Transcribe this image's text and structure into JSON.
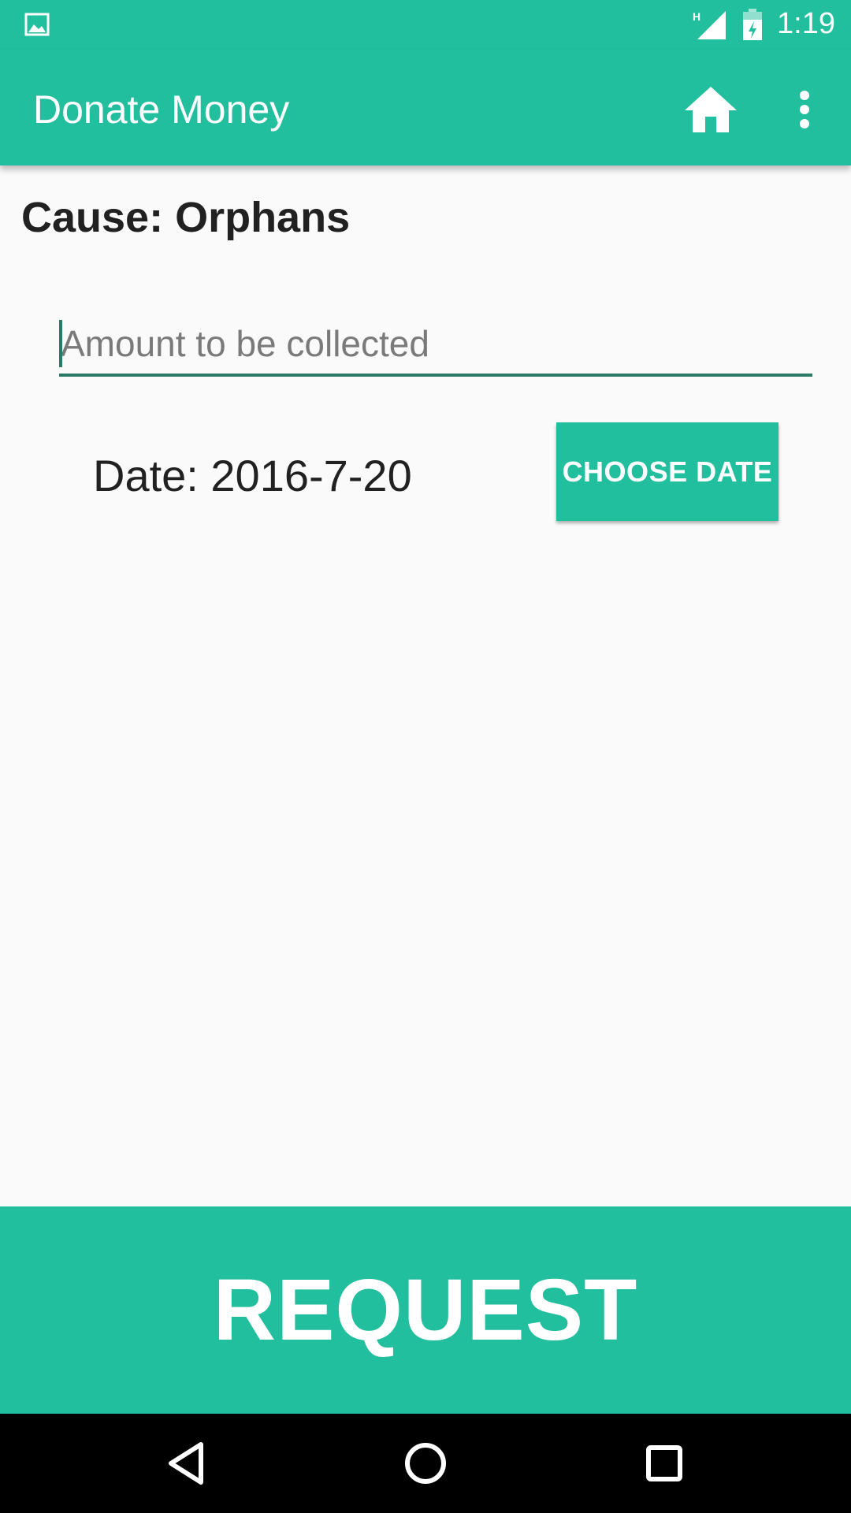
{
  "status_bar": {
    "time": "1:19",
    "network_label": "H",
    "icons": [
      "gallery-icon",
      "signal-icon",
      "battery-charging-icon"
    ]
  },
  "app_bar": {
    "title": "Donate Money",
    "icons": [
      "home-icon",
      "more-vert-icon"
    ]
  },
  "form": {
    "cause_label": "Cause: Orphans",
    "amount": {
      "value": "",
      "placeholder": "Amount to be collected"
    },
    "date_label": "Date: 2016-7-20",
    "choose_date_label": "CHOOSE DATE"
  },
  "request_label": "REQUEST",
  "nav_bar": {
    "icons": [
      "back-icon",
      "home-circle-icon",
      "recents-icon"
    ]
  },
  "colors": {
    "primary": "#22bf9e",
    "accent_dark": "#2b7a66",
    "background": "#fafafa",
    "text": "#212121"
  }
}
